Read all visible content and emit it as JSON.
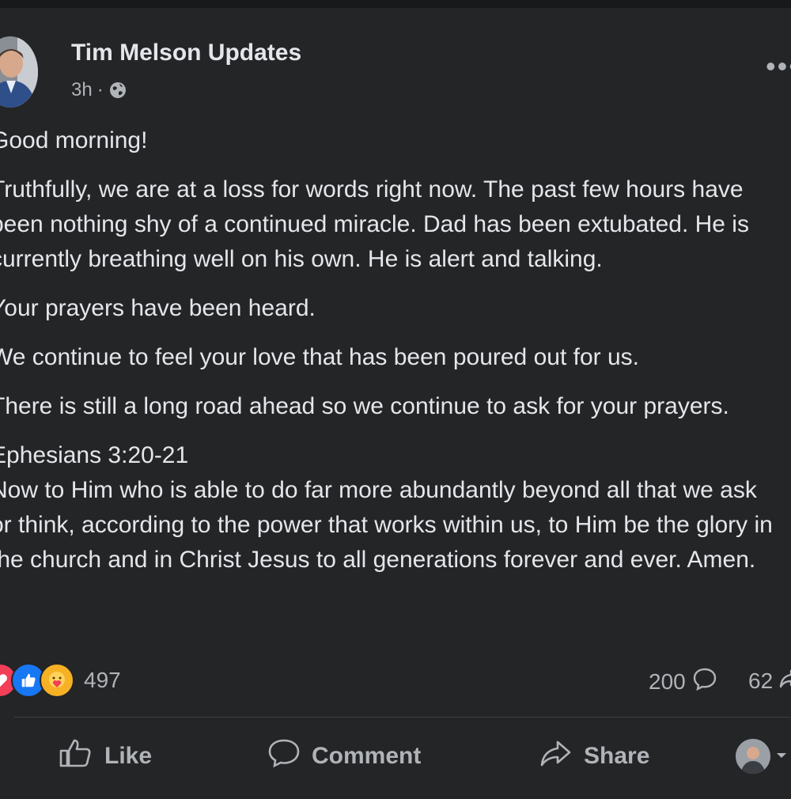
{
  "post": {
    "author": "Tim Melson Updates",
    "time": "3h",
    "separator": "·",
    "visibility_icon": "globe-icon",
    "more_label": "•••",
    "paragraphs": [
      "Good morning!",
      "Truthfully, we are at a loss for words right now. The past few hours have been nothing shy of a continued miracle. Dad has been extubated. He is currently breathing well on his own. He is alert and talking.",
      "Your prayers have been heard.",
      "We continue to feel your love that has been poured out for us.",
      "There is still a long road ahead so we continue to ask for your prayers."
    ],
    "verse_ref": "Ephesians 3:20-21",
    "verse_text": "Now to Him who is able to do far more abundantly beyond all that we ask or think, according to the power that works within us, to Him be the glory in the church and in Christ Jesus to all generations forever and ever. Amen."
  },
  "stats": {
    "reaction_icons": [
      "love-icon",
      "like-icon",
      "care-icon"
    ],
    "reactions_count": "497",
    "comments_count": "200",
    "shares_count": "62"
  },
  "actions": {
    "like": "Like",
    "comment": "Comment",
    "share": "Share"
  },
  "colors": {
    "background": "#18191a",
    "card": "#242526",
    "text_primary": "#e4e6eb",
    "text_secondary": "#b0b3b8",
    "love": "#f33e58",
    "like": "#1877f2",
    "care": "#f7b125"
  }
}
